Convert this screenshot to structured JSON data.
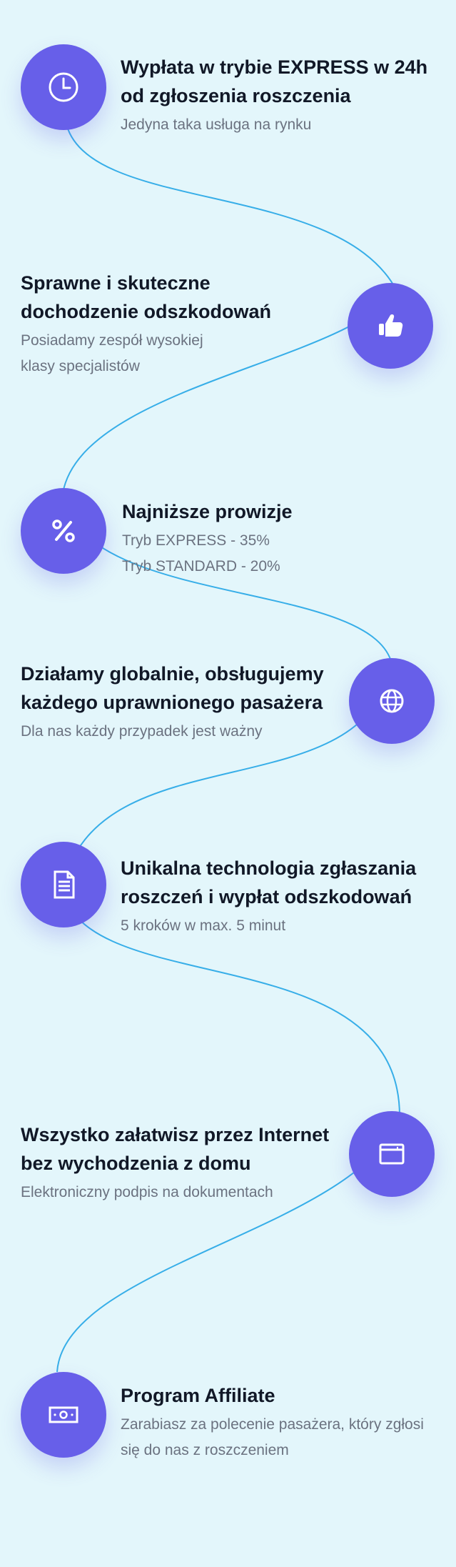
{
  "items": [
    {
      "title_line1": "Wypłata w trybie EXPRESS w 24h",
      "title_line2": "od zgłoszenia roszczenia",
      "desc_line1": "Jedyna taka usługa na rynku",
      "icon": "clock-icon"
    },
    {
      "title_line1": "Sprawne i skuteczne",
      "title_line2": "dochodzenie odszkodowań",
      "desc_line1": "Posiadamy zespół wysokiej",
      "desc_line2": "klasy specjalistów",
      "icon": "thumbs-up-icon"
    },
    {
      "title_line1": "Najniższe prowizje",
      "desc_line1": "Tryb EXPRESS - 35%",
      "desc_line2": "Tryb STANDARD - 20%",
      "icon": "percent-icon"
    },
    {
      "title_line1": "Działamy globalnie, obsługujemy",
      "title_line2": "każdego uprawnionego pasażera",
      "desc_line1": "Dla nas każdy przypadek jest ważny",
      "icon": "globe-icon"
    },
    {
      "title_line1": "Unikalna technologia zgłaszania",
      "title_line2": "roszczeń i wypłat odszkodowań",
      "desc_line1": "5 kroków w max. 5 minut",
      "icon": "document-icon"
    },
    {
      "title_line1": "Wszystko załatwisz przez Internet",
      "title_line2": "bez wychodzenia z domu",
      "desc_line1": "Elektroniczny podpis na dokumentach",
      "icon": "browser-window-icon"
    },
    {
      "title_line1": "Program Affiliate",
      "desc_line1": "Zarabiasz za polecenie pasażera, który zgłosi",
      "desc_line2": "się do nas z roszczeniem",
      "icon": "money-bill-icon"
    }
  ],
  "colors": {
    "background": "#e3f6fb",
    "circle": "#675fe9",
    "connector": "#37aee8",
    "title": "#111827",
    "description": "#6b7280"
  }
}
